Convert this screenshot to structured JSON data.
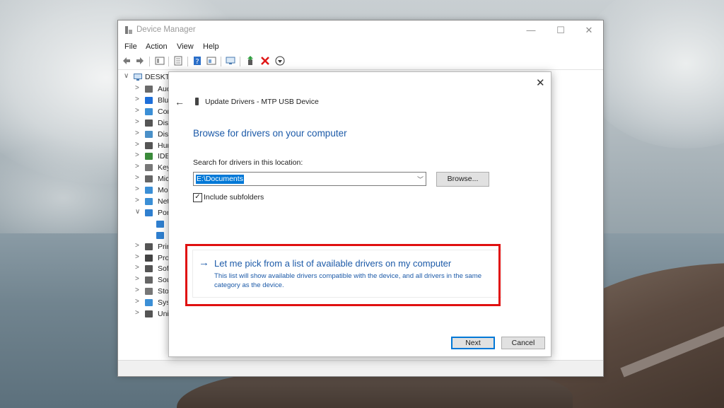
{
  "device_manager": {
    "title": "Device Manager",
    "window_controls": {
      "minimize": "—",
      "maximize": "☐",
      "close": "✕"
    },
    "menu": [
      "File",
      "Action",
      "View",
      "Help"
    ],
    "toolbar_icons": [
      "back-arrow-icon",
      "forward-arrow-icon",
      "properties-icon",
      "list-icon",
      "help-icon",
      "details-icon",
      "monitor-icon",
      "update-driver-icon",
      "uninstall-icon",
      "download-icon"
    ],
    "tree": {
      "root": {
        "chevron": "∨",
        "label": "DESKTO"
      },
      "items": [
        {
          "chevron": ">",
          "label": "Aud",
          "icon_color": "#6a6a6a"
        },
        {
          "chevron": ">",
          "label": "Blu",
          "icon_color": "#1e6fd9"
        },
        {
          "chevron": ">",
          "label": "Cor",
          "icon_color": "#3b8fd6"
        },
        {
          "chevron": ">",
          "label": "Disl",
          "icon_color": "#555555"
        },
        {
          "chevron": ">",
          "label": "Disp",
          "icon_color": "#4a90c8"
        },
        {
          "chevron": ">",
          "label": "Hur",
          "icon_color": "#555555"
        },
        {
          "chevron": ">",
          "label": "IDE",
          "icon_color": "#3a8a3a"
        },
        {
          "chevron": ">",
          "label": "Key",
          "icon_color": "#777777"
        },
        {
          "chevron": ">",
          "label": "Mic",
          "icon_color": "#666666"
        },
        {
          "chevron": ">",
          "label": "Mo",
          "icon_color": "#3b8fd6"
        },
        {
          "chevron": ">",
          "label": "Net",
          "icon_color": "#3b8fd6"
        },
        {
          "chevron": "∨",
          "label": "Por",
          "icon_color": "#2f7fcf"
        },
        {
          "chevron": "",
          "label": "",
          "icon_color": "#2f7fcf"
        },
        {
          "chevron": "",
          "label": "",
          "icon_color": "#2f7fcf"
        },
        {
          "chevron": ">",
          "label": "Prir",
          "icon_color": "#555555"
        },
        {
          "chevron": ">",
          "label": "Pro",
          "icon_color": "#444444"
        },
        {
          "chevron": ">",
          "label": "Sof",
          "icon_color": "#555555"
        },
        {
          "chevron": ">",
          "label": "Sou",
          "icon_color": "#666666"
        },
        {
          "chevron": ">",
          "label": "Sto",
          "icon_color": "#777777"
        },
        {
          "chevron": ">",
          "label": "Sys",
          "icon_color": "#3b8fd6"
        },
        {
          "chevron": ">",
          "label": "Uni",
          "icon_color": "#555555"
        }
      ]
    }
  },
  "dialog": {
    "close": "✕",
    "back": "←",
    "header": "Update Drivers - MTP USB Device",
    "heading": "Browse for drivers on your computer",
    "search_label": "Search for drivers in this location:",
    "search_value": "E:\\Documents",
    "browse_button": "Browse...",
    "include_subfolders_label": "Include subfolders",
    "include_subfolders_checked": "✓",
    "option": {
      "arrow": "→",
      "title": "Let me pick from a list of available drivers on my computer",
      "description": "This list will show available drivers compatible with the device, and all drivers in the same category as the device."
    },
    "next_button": "Next",
    "cancel_button": "Cancel"
  },
  "colors": {
    "link_blue": "#1c5aa8",
    "highlight_red": "#e01010",
    "selection_blue": "#0078d7"
  }
}
